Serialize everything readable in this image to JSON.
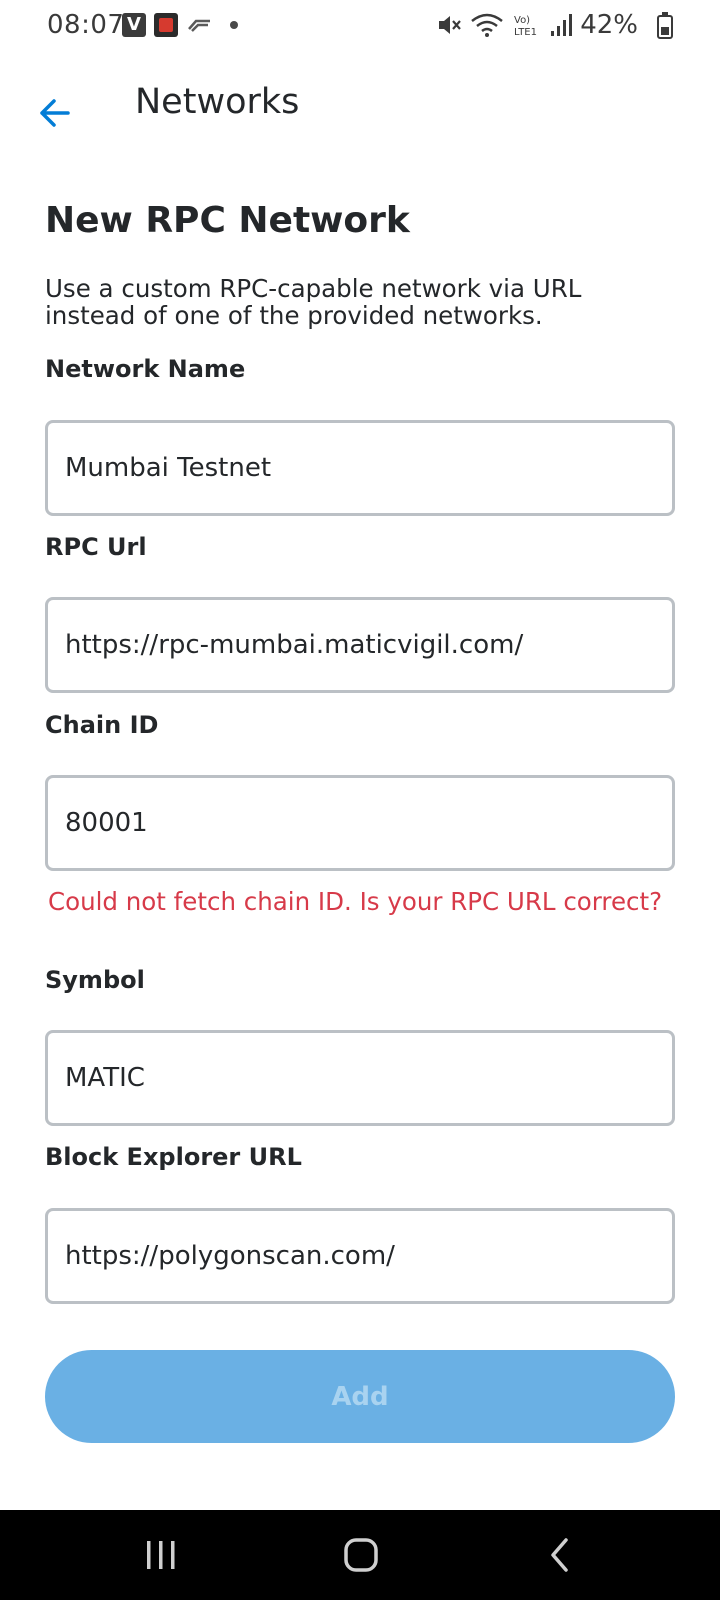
{
  "status_bar": {
    "time": "08:07",
    "battery": "42%",
    "network_label": "LTE1"
  },
  "header": {
    "title": "Networks"
  },
  "page": {
    "title": "New RPC Network",
    "description": "Use a custom RPC-capable network via URL instead of one of the provided networks."
  },
  "form": {
    "network_name": {
      "label": "Network Name",
      "value": "Mumbai Testnet"
    },
    "rpc_url": {
      "label": "RPC Url",
      "value": "https://rpc-mumbai.maticvigil.com/"
    },
    "chain_id": {
      "label": "Chain ID",
      "value": "80001",
      "error": "Could not fetch chain ID. Is your RPC URL correct?"
    },
    "symbol": {
      "label": "Symbol",
      "value": "MATIC"
    },
    "block_explorer_url": {
      "label": "Block Explorer URL",
      "value": "https://polygonscan.com/"
    }
  },
  "actions": {
    "add_label": "Add"
  },
  "colors": {
    "accent": "#037dd6",
    "button_disabled": "#6ab0e4",
    "error": "#d73a49",
    "border": "#bbc0c5"
  }
}
